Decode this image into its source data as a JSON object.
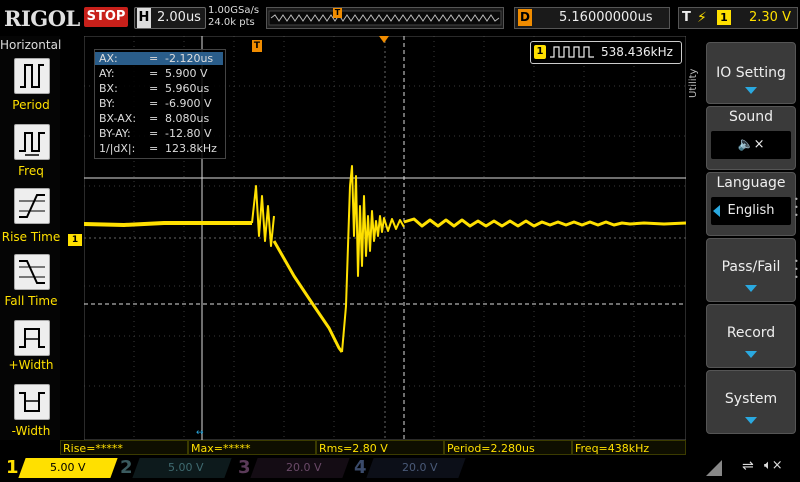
{
  "header": {
    "brand": "RIGOL",
    "run_state": "STOP",
    "horizontal_letter": "H",
    "horizontal_scale": "2.00us",
    "sample_rate": "1.00GSa/s",
    "memory_depth": "24.0k pts",
    "delay_letter": "D",
    "delay_value": "5.16000000us",
    "trigger_letter": "T",
    "trigger_channel": "1",
    "trigger_level": "2.30 V"
  },
  "left_panel": {
    "title": "Horizontal",
    "items": [
      {
        "label": "Period",
        "icon": "period-icon"
      },
      {
        "label": "Freq",
        "icon": "freq-icon"
      },
      {
        "label": "Rise Time",
        "icon": "rise-time-icon"
      },
      {
        "label": "Fall Time",
        "icon": "fall-time-icon"
      },
      {
        "label": "+Width",
        "icon": "pos-width-icon"
      },
      {
        "label": "-Width",
        "icon": "neg-width-icon"
      }
    ]
  },
  "cursor_readout": [
    {
      "key": "AX:",
      "value": "-2.120us"
    },
    {
      "key": "AY:",
      "value": "5.900 V"
    },
    {
      "key": "BX:",
      "value": "5.960us"
    },
    {
      "key": "BY:",
      "value": "-6.900 V"
    },
    {
      "key": "BX-AX:",
      "value": "8.080us"
    },
    {
      "key": "BY-AY:",
      "value": "-12.80 V"
    },
    {
      "key": "1/|dX|:",
      "value": "123.8kHz"
    }
  ],
  "frequency_counter": {
    "channel": "1",
    "value": "538.436kHz"
  },
  "markers": {
    "channel1": "1",
    "trigger": "T"
  },
  "right_menu": {
    "title": "Utility",
    "items": [
      {
        "label": "IO Setting"
      },
      {
        "label": "Sound",
        "value": "🔈×"
      },
      {
        "label": "Language",
        "value": "English"
      },
      {
        "label": "Pass/Fail"
      },
      {
        "label": "Record"
      },
      {
        "label": "System"
      }
    ]
  },
  "measurements": [
    {
      "text": "Rise=*****"
    },
    {
      "text": "Max=*****"
    },
    {
      "text": "Rms=2.80 V"
    },
    {
      "text": "Period=2.280us"
    },
    {
      "text": "Freq=438kHz"
    }
  ],
  "channels": [
    {
      "num": "1",
      "scale": "5.00 V"
    },
    {
      "num": "2",
      "scale": "5.00 V"
    },
    {
      "num": "3",
      "scale": "20.0 V"
    },
    {
      "num": "4",
      "scale": "20.0 V"
    }
  ],
  "colors": {
    "ch1": "#ffe000",
    "ch2": "#00c8d8",
    "ch3": "#e040c8",
    "ch4": "#2a6ad8",
    "trigger": "#f08c00",
    "menu_arrow": "#2aa9e0"
  }
}
